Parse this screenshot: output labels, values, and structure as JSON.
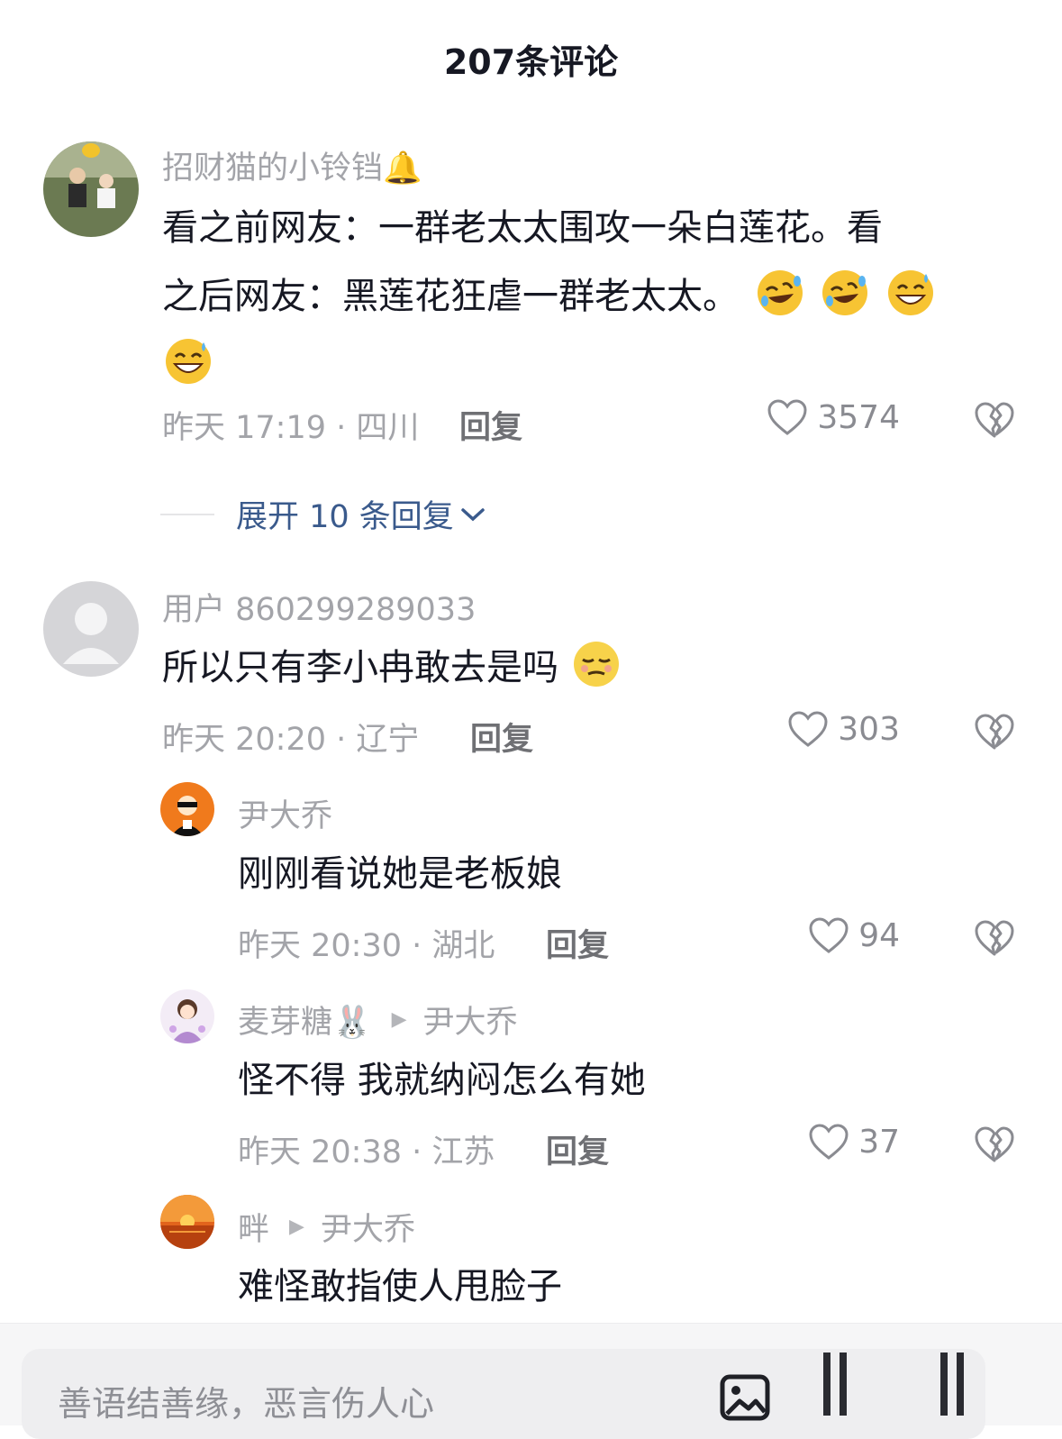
{
  "header": {
    "title": "207条评论"
  },
  "comments": [
    {
      "username": "招财猫的小铃铛🔔",
      "text_line1": "看之前网友：一群老太太围攻一朵白莲花。看",
      "text_line2": "之后网友：黑莲花狂虐一群老太太。",
      "emojis": [
        "laughing-rolling-emoji",
        "laughing-rolling-emoji",
        "grinning-sweat-emoji",
        "grinning-sweat-emoji"
      ],
      "meta": "昨天 17:19 · 四川",
      "reply_label": "回复",
      "likes": "3574",
      "expand_label": "展开 10 条回复"
    },
    {
      "username": "用户 860299289033",
      "text": "所以只有李小冉敢去是吗",
      "emojis": [
        "relieved-face-emoji"
      ],
      "meta": "昨天 20:20 · 辽宁",
      "reply_label": "回复",
      "likes": "303"
    }
  ],
  "replies": [
    {
      "username": "尹大乔",
      "text": "刚刚看说她是老板娘",
      "meta": "昨天 20:30 · 湖北",
      "reply_label": "回复",
      "likes": "94"
    },
    {
      "username": "麦芽糖🐰",
      "reply_to": "尹大乔",
      "text": "怪不得 我就纳闷怎么有她",
      "meta": "昨天 20:38 · 江苏",
      "reply_label": "回复",
      "likes": "37"
    },
    {
      "username": "畔",
      "reply_to": "尹大乔",
      "text": "难怪敢指使人甩脸子"
    }
  ],
  "input": {
    "placeholder": "善语结善缘，恶言伤人心"
  },
  "colors": {
    "text": "#161823",
    "secondary": "#a3a4a9",
    "link": "#3a5a8c"
  }
}
